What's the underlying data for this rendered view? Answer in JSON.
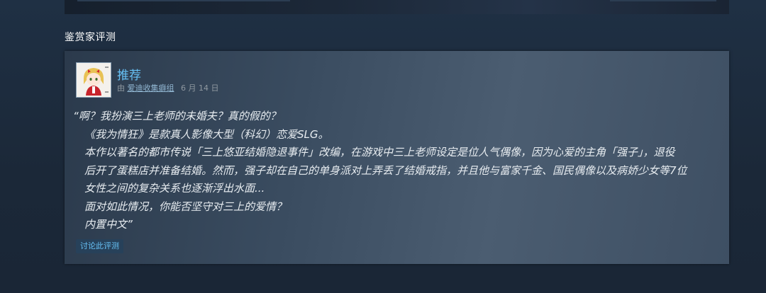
{
  "section": {
    "title": "鉴赏家评测"
  },
  "review": {
    "recommendation": "推荐",
    "by_prefix": "由",
    "curator_name": "爱迪收集癖组",
    "date": "6 月 14 日",
    "lines": [
      "“啊？我扮演三上老师的未婚夫？真的假的？",
      "《我为情狂》是款真人影像大型（科幻）恋爱SLG。",
      "本作以著名的都市传说「三上悠亚结婚隐退事件」改编，在游戏中三上老师设定是位人气偶像，因为心爱的主角「强子」，退役",
      "后开了蛋糕店并准备结婚。然而，强子却在自己的单身派对上弄丢了结婚戒指，并且他与富家千金、国民偶像以及病娇少女等7位",
      "女性之间的复杂关系也逐渐浮出水面...",
      "面对如此情况，你能否坚守对三上的爱情？",
      "内置中文”"
    ],
    "discuss_button": "讨论此评测"
  },
  "colors": {
    "page_bg": "#1b2838",
    "accent_blue": "#67c1f5",
    "card_gradient_mid": "#4b5d71"
  },
  "icons": {
    "avatar": "curator-avatar-icon"
  }
}
